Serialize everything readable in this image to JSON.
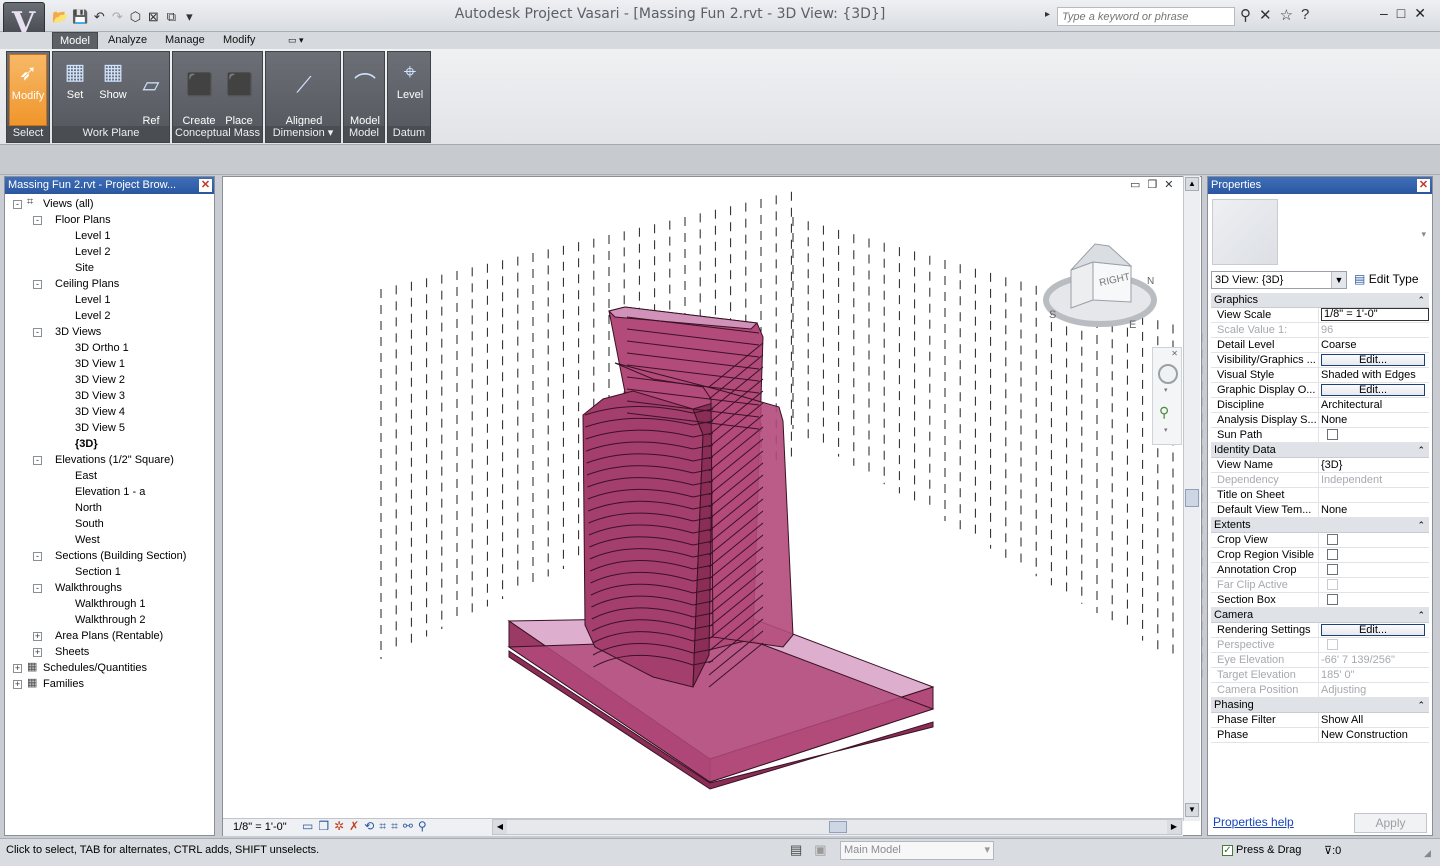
{
  "app": {
    "title": "Autodesk Project Vasari - [Massing Fun 2.rvt - 3D View: {3D}]",
    "search_placeholder": "Type a keyword or phrase"
  },
  "ribbon": {
    "tabs": [
      "Model",
      "Analyze",
      "Manage",
      "Modify"
    ],
    "active_tab": "Model",
    "panels": [
      {
        "label": "Select",
        "buttons": [
          "Modify"
        ]
      },
      {
        "label": "Work Plane",
        "buttons": [
          "Set",
          "Show",
          "Ref\nPlane"
        ]
      },
      {
        "label": "Conceptual Mass",
        "buttons": [
          "Create\nMass",
          "Place\nMass"
        ]
      },
      {
        "label": "Dimension",
        "buttons": [
          "Aligned\nDimension"
        ]
      },
      {
        "label": "Model",
        "buttons": [
          "Model\nLine"
        ]
      },
      {
        "label": "Datum",
        "buttons": [
          "Level"
        ]
      }
    ]
  },
  "browser": {
    "title": "Massing Fun 2.rvt - Project Brow...",
    "tree": [
      {
        "label": "Views (all)",
        "level": 0,
        "toggle": "-"
      },
      {
        "label": "Floor Plans",
        "level": 1,
        "toggle": "-"
      },
      {
        "label": "Level 1",
        "level": 2
      },
      {
        "label": "Level 2",
        "level": 2
      },
      {
        "label": "Site",
        "level": 2
      },
      {
        "label": "Ceiling Plans",
        "level": 1,
        "toggle": "-"
      },
      {
        "label": "Level 1",
        "level": 2
      },
      {
        "label": "Level 2",
        "level": 2
      },
      {
        "label": "3D Views",
        "level": 1,
        "toggle": "-"
      },
      {
        "label": "3D Ortho 1",
        "level": 2
      },
      {
        "label": "3D View 1",
        "level": 2
      },
      {
        "label": "3D View 2",
        "level": 2
      },
      {
        "label": "3D View 3",
        "level": 2
      },
      {
        "label": "3D View 4",
        "level": 2
      },
      {
        "label": "3D View 5",
        "level": 2
      },
      {
        "label": "{3D}",
        "level": 2,
        "bold": true
      },
      {
        "label": "Elevations (1/2\" Square)",
        "level": 1,
        "toggle": "-"
      },
      {
        "label": "East",
        "level": 2
      },
      {
        "label": "Elevation 1 - a",
        "level": 2
      },
      {
        "label": "North",
        "level": 2
      },
      {
        "label": "South",
        "level": 2
      },
      {
        "label": "West",
        "level": 2
      },
      {
        "label": "Sections (Building Section)",
        "level": 1,
        "toggle": "-"
      },
      {
        "label": "Section 1",
        "level": 2
      },
      {
        "label": "Walkthroughs",
        "level": 1,
        "toggle": "-"
      },
      {
        "label": "Walkthrough 1",
        "level": 2
      },
      {
        "label": "Walkthrough 2",
        "level": 2
      },
      {
        "label": "Area Plans (Rentable)",
        "level": 1,
        "toggle": "+"
      },
      {
        "label": "Sheets",
        "level": 1,
        "toggle": "+"
      },
      {
        "label": "Schedules/Quantities",
        "level": 0,
        "toggle": "+"
      },
      {
        "label": "Families",
        "level": 0,
        "toggle": "+"
      }
    ]
  },
  "view": {
    "scale": "1/8\" = 1'-0\"",
    "viewcube": {
      "face": "RIGHT",
      "compass": [
        "S",
        "E",
        "N"
      ]
    }
  },
  "properties": {
    "title": "Properties",
    "type_selector": "3D View: {3D}",
    "edit_type": "Edit Type",
    "groups": [
      {
        "name": "Graphics",
        "rows": [
          {
            "k": "View Scale",
            "v": "1/8\" = 1'-0\"",
            "kind": "input"
          },
          {
            "k": "Scale Value    1:",
            "v": "96",
            "disabled": true
          },
          {
            "k": "Detail Level",
            "v": "Coarse"
          },
          {
            "k": "Visibility/Graphics ...",
            "v": "Edit...",
            "kind": "button"
          },
          {
            "k": "Visual Style",
            "v": "Shaded with Edges"
          },
          {
            "k": "Graphic Display O...",
            "v": "Edit...",
            "kind": "button"
          },
          {
            "k": "Discipline",
            "v": "Architectural"
          },
          {
            "k": "Analysis Display S...",
            "v": "None"
          },
          {
            "k": "Sun Path",
            "v": "",
            "kind": "check"
          }
        ]
      },
      {
        "name": "Identity Data",
        "rows": [
          {
            "k": "View Name",
            "v": "{3D}"
          },
          {
            "k": "Dependency",
            "v": "Independent",
            "disabled": true
          },
          {
            "k": "Title on Sheet",
            "v": ""
          },
          {
            "k": "Default View Tem...",
            "v": "None"
          }
        ]
      },
      {
        "name": "Extents",
        "rows": [
          {
            "k": "Crop View",
            "v": "",
            "kind": "check"
          },
          {
            "k": "Crop Region Visible",
            "v": "",
            "kind": "check"
          },
          {
            "k": "Annotation Crop",
            "v": "",
            "kind": "check"
          },
          {
            "k": "Far Clip Active",
            "v": "",
            "kind": "check",
            "disabled": true
          },
          {
            "k": "Section Box",
            "v": "",
            "kind": "check"
          }
        ]
      },
      {
        "name": "Camera",
        "rows": [
          {
            "k": "Rendering Settings",
            "v": "Edit...",
            "kind": "button"
          },
          {
            "k": "Perspective",
            "v": "",
            "kind": "check",
            "disabled": true
          },
          {
            "k": "Eye Elevation",
            "v": "-66'  7 139/256\"",
            "disabled": true
          },
          {
            "k": "Target Elevation",
            "v": "185'  0\"",
            "disabled": true
          },
          {
            "k": "Camera Position",
            "v": "Adjusting",
            "disabled": true
          }
        ]
      },
      {
        "name": "Phasing",
        "rows": [
          {
            "k": "Phase Filter",
            "v": "Show All"
          },
          {
            "k": "Phase",
            "v": "New Construction"
          }
        ]
      }
    ],
    "help_link": "Properties help",
    "apply": "Apply"
  },
  "statusbar": {
    "hint": "Click to select, TAB for alternates, CTRL adds, SHIFT unselects.",
    "model": "Main Model",
    "press_drag": "Press & Drag",
    "filter_count": ":0"
  },
  "colors": {
    "mass_fill": "#b24a7a",
    "mass_edge": "#3a1224",
    "mass_light": "#d49ac0",
    "panel_header": "#2d5aa5",
    "ribbon_panel": "#5f6268",
    "selected_tool": "#f0962c"
  }
}
